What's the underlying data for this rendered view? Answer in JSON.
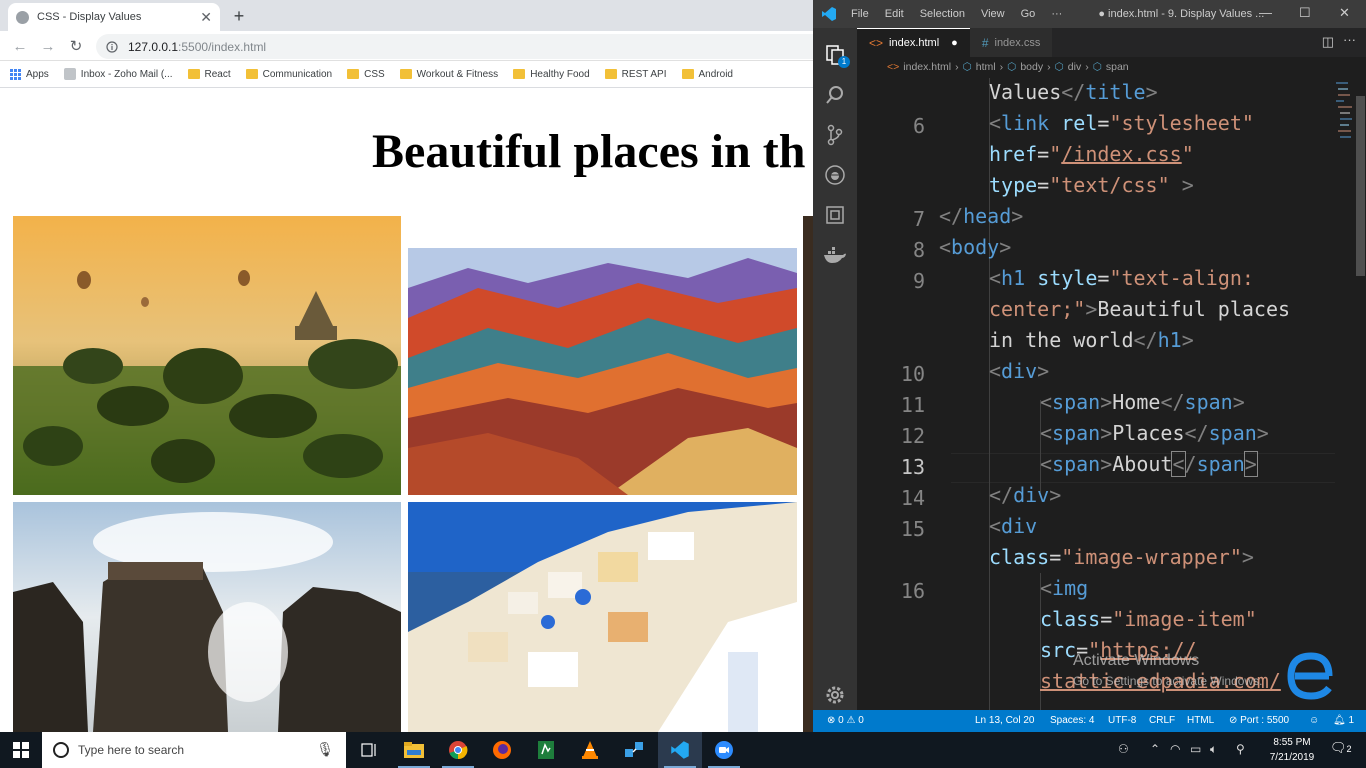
{
  "browser": {
    "tab_title": "CSS - Display Values",
    "url_host": "127.0.0.1",
    "url_path": ":5500/index.html",
    "bookmarks": [
      "Apps",
      "Inbox - Zoho Mail (...",
      "React",
      "Communication",
      "CSS",
      "Workout & Fitness",
      "Healthy Food",
      "REST API",
      "Android"
    ],
    "page_heading": "Beautiful places in th",
    "photos": [
      "Hot air balloons over misty temple plain",
      "Colorful rainbow mountains",
      "Monastery on rocks in the clouds",
      "White houses on a seaside cliff"
    ]
  },
  "vscode": {
    "menu": [
      "File",
      "Edit",
      "Selection",
      "View",
      "Go",
      "···"
    ],
    "window_title": "● index.html - 9. Display Values ...",
    "tabs": [
      {
        "label": "index.html",
        "dirty": "●"
      },
      {
        "label": "index.css"
      }
    ],
    "breadcrumbs": [
      "index.html",
      "html",
      "body",
      "div",
      "span"
    ],
    "line_numbers": [
      "6",
      "7",
      "8",
      "9",
      "10",
      "11",
      "12",
      "13",
      "14",
      "15",
      "16"
    ],
    "status": {
      "errors": "0",
      "warnings": "0",
      "position": "Ln 13, Col 20",
      "spaces": "Spaces: 4",
      "encoding": "UTF-8",
      "eol": "CRLF",
      "language": "HTML",
      "port": "Port : 5500",
      "notifications": "1"
    }
  },
  "watermark": {
    "line1": "Activate Windows",
    "line2": "Go to Settings to activate Windows."
  },
  "taskbar": {
    "search_placeholder": "Type here to search",
    "time": "8:55 PM",
    "date": "7/21/2019",
    "notifications": "2"
  },
  "colors": {
    "vscode_statusbar": "#007acc",
    "editor_bg": "#1e1e1e",
    "tag_name": "#569cd6",
    "attr_name": "#9cdcfe",
    "string": "#ce9178"
  }
}
